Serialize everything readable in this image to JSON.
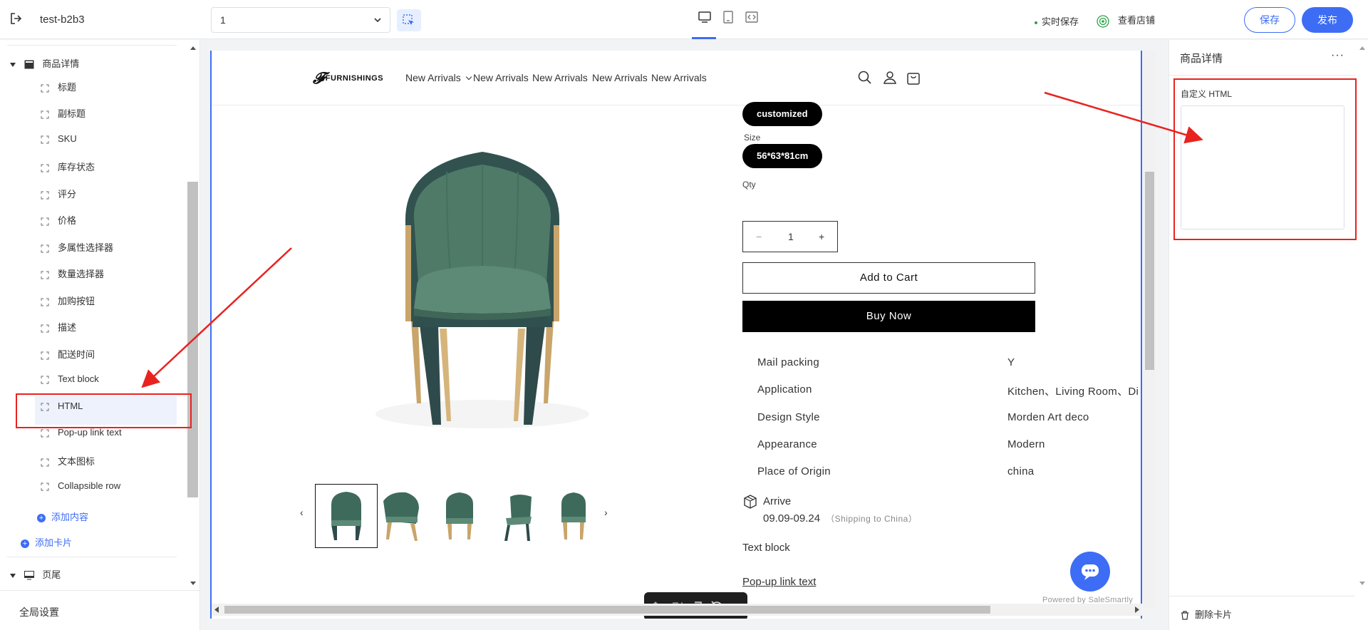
{
  "topbar": {
    "store_name": "test-b2b3",
    "page_select_value": "1",
    "autosave_label": "实时保存",
    "view_store_label": "查看店铺",
    "save_label": "保存",
    "publish_label": "发布"
  },
  "sidebar": {
    "section_product_detail": "商品详情",
    "items": [
      {
        "label": "标题"
      },
      {
        "label": "副标题"
      },
      {
        "label": "SKU"
      },
      {
        "label": "库存状态"
      },
      {
        "label": "评分"
      },
      {
        "label": "价格"
      },
      {
        "label": "多属性选择器"
      },
      {
        "label": "数量选择器"
      },
      {
        "label": "加购按钮"
      },
      {
        "label": "描述"
      },
      {
        "label": "配送时间"
      },
      {
        "label": "Text block"
      },
      {
        "label": "HTML"
      },
      {
        "label": "Pop-up link text"
      },
      {
        "label": "文本图标"
      },
      {
        "label": "Collapsible row"
      }
    ],
    "add_content_label": "添加内容",
    "add_card_label": "添加卡片",
    "section_footer": "页尾",
    "global_settings_label": "全局设置"
  },
  "store": {
    "logo_text": "FURNISHINGS",
    "nav": [
      "New Arrivals",
      "New Arrivals",
      "New Arrivals",
      "New Arrivals",
      "New Arrivals"
    ],
    "variant_pill": "customized",
    "size_label": "Size",
    "size_value": "56*63*81cm",
    "qty_label": "Qty",
    "qty_minus": "−",
    "qty_value": "1",
    "qty_plus": "+",
    "add_to_cart": "Add to Cart",
    "buy_now": "Buy Now",
    "specs": [
      {
        "key": "Mail packing",
        "value": "Y"
      },
      {
        "key": "Application",
        "value": "Kitchen、Living Room、Di"
      },
      {
        "key": "Design Style",
        "value": "Morden Art deco"
      },
      {
        "key": "Appearance",
        "value": "Modern"
      },
      {
        "key": "Place of Origin",
        "value": "china"
      }
    ],
    "arrive_label": "Arrive",
    "arrive_dates": "09.09-09.24",
    "arrive_note": "（Shipping to China）",
    "text_block": "Text block",
    "popup_link": "Pop-up link text",
    "powered_by": "Powered by SaleSmartly",
    "thumb_prev": "‹",
    "thumb_next": "›"
  },
  "right_panel": {
    "title": "商品详情",
    "more": "···",
    "field_label": "自定义 HTML",
    "field_value": "",
    "delete_card": "删除卡片"
  },
  "colors": {
    "accent": "#3d6df5",
    "chair_green": "#4f7a68",
    "annotation_red": "#e8231f"
  }
}
